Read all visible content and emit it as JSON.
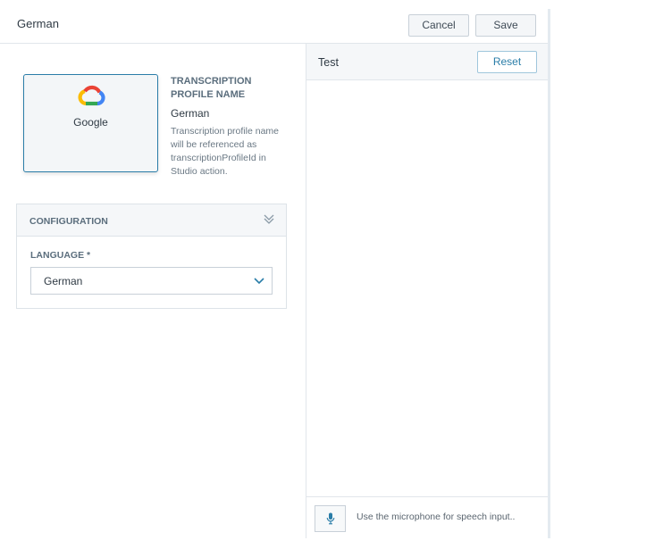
{
  "header": {
    "title": "German",
    "cancel_label": "Cancel",
    "save_label": "Save"
  },
  "provider": {
    "name": "Google",
    "icon": "google-cloud-icon"
  },
  "profile": {
    "label": "TRANSCRIPTION PROFILE NAME",
    "value": "German",
    "help": "Transcription profile name will be referenced as transcriptionProfileId in Studio action."
  },
  "configuration": {
    "title": "CONFIGURATION",
    "language_label": "LANGUAGE *",
    "language_value": "German"
  },
  "test": {
    "title": "Test",
    "reset_label": "Reset",
    "speech_placeholder": "Use the microphone for speech input.."
  },
  "colors": {
    "accent": "#2a7da8",
    "border": "#dde3e8",
    "header_bg": "#f5f7f9"
  }
}
